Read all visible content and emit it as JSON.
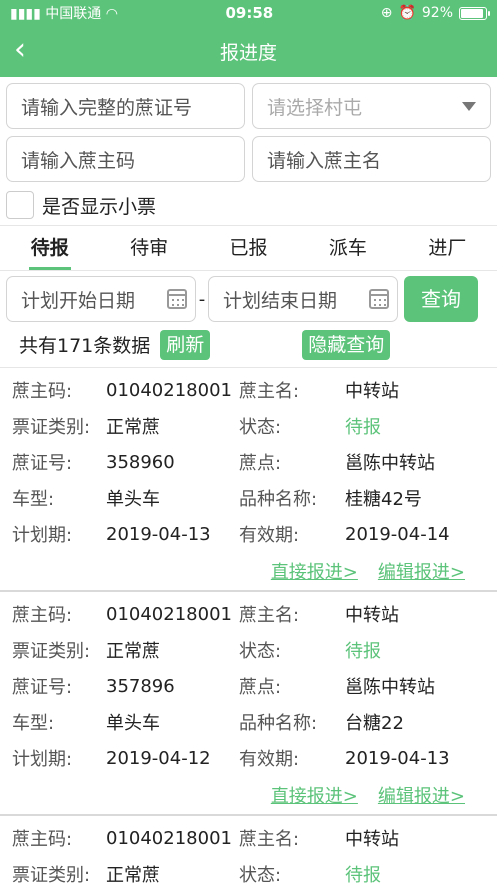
{
  "status_bar": {
    "carrier": "中国联通",
    "time": "09:58",
    "battery": "92%",
    "battery_level": 0.92
  },
  "nav": {
    "title": "报进度"
  },
  "filters": {
    "cane_cert_placeholder": "请输入完整的蔗证号",
    "village_placeholder": "请选择村屯",
    "farmer_code_placeholder": "请输入蔗主码",
    "farmer_name_placeholder": "请输入蔗主名",
    "show_ticket_label": "是否显示小票"
  },
  "tabs": [
    "待报",
    "待审",
    "已报",
    "派车",
    "进厂"
  ],
  "active_tab": 0,
  "date_filter": {
    "start_placeholder": "计划开始日期",
    "separator": "-",
    "end_placeholder": "计划结束日期",
    "query_label": "查询"
  },
  "summary": {
    "count_text": "共有171条数据",
    "refresh_label": "刷新",
    "hide_query_label": "隐藏查询"
  },
  "labels": {
    "farmer_code": "蔗主码:",
    "farmer_name": "蔗主名:",
    "cert_type": "票证类别:",
    "status": "状态:",
    "cert_no": "蔗证号:",
    "point": "蔗点:",
    "vehicle": "车型:",
    "variety": "品种名称:",
    "plan_date": "计划期:",
    "valid_date": "有效期:"
  },
  "records": [
    {
      "farmer_code": "01040218001",
      "farmer_name": "中转站",
      "cert_type": "正常蔗",
      "status": "待报",
      "cert_no": "358960",
      "point": "邕陈中转站",
      "vehicle": "单头车",
      "variety": "桂糖42号",
      "plan_date": "2019-04-13",
      "valid_date": "2019-04-14",
      "direct_link": "直接报进>",
      "edit_link": "编辑报进>"
    },
    {
      "farmer_code": "01040218001",
      "farmer_name": "中转站",
      "cert_type": "正常蔗",
      "status": "待报",
      "cert_no": "357896",
      "point": "邕陈中转站",
      "vehicle": "单头车",
      "variety": "台糖22",
      "plan_date": "2019-04-12",
      "valid_date": "2019-04-13",
      "direct_link": "直接报进>",
      "edit_link": "编辑报进>"
    },
    {
      "farmer_code": "01040218001",
      "farmer_name": "中转站",
      "cert_type": "正常蔗",
      "status": "待报"
    }
  ]
}
